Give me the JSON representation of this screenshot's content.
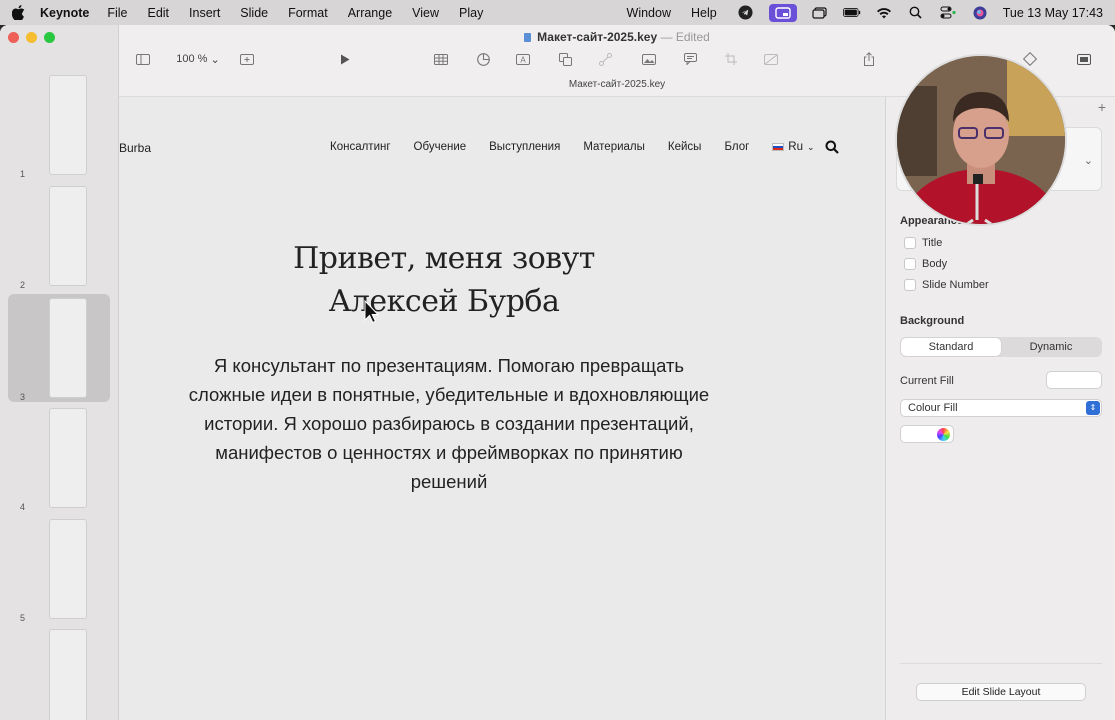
{
  "menubar": {
    "app": "Keynote",
    "items": [
      "File",
      "Edit",
      "Insert",
      "Slide",
      "Format",
      "Arrange",
      "View",
      "Play"
    ],
    "window": "Window",
    "help": "Help",
    "clock": "Tue 13 May  17:43"
  },
  "document": {
    "filename": "Макет-сайт-2025.key",
    "separator": "—",
    "status": "Edited",
    "tab_title": "Макет-сайт-2025.key",
    "zoom": "100 %"
  },
  "slides": [
    {
      "number": "1"
    },
    {
      "number": "2"
    },
    {
      "number": "3",
      "selected": true
    },
    {
      "number": "4"
    },
    {
      "number": "5"
    },
    {
      "number": ""
    }
  ],
  "slide": {
    "logo_text": "Burba",
    "nav": [
      "Консалтинг",
      "Обучение",
      "Выступления",
      "Материалы",
      "Кейсы",
      "Блог"
    ],
    "language": "Ru",
    "title_line1": "Привет, меня зовут",
    "title_line2": "Алексей Бурба",
    "body": "Я консультант по презентациям. Помогаю превращать сложные идеи в понятные, убедительные и вдохновляющие истории. Я хорошо разбираюсь в создании презентаций, манифестов о ценностях и фреймворках по принятию решений"
  },
  "inspector": {
    "appearance_title": "Appearance",
    "checks": [
      "Title",
      "Body",
      "Slide Number"
    ],
    "background_title": "Background",
    "seg_standard": "Standard",
    "seg_dynamic": "Dynamic",
    "current_fill": "Current Fill",
    "fill_type": "Colour Fill",
    "edit_layout": "Edit Slide Layout"
  },
  "colors": {
    "accent": "#2f6fd6",
    "menubar_active": "#6a4fd8",
    "close": "#ee5f57",
    "minimize": "#f5bd2f",
    "maximize": "#29c840"
  }
}
